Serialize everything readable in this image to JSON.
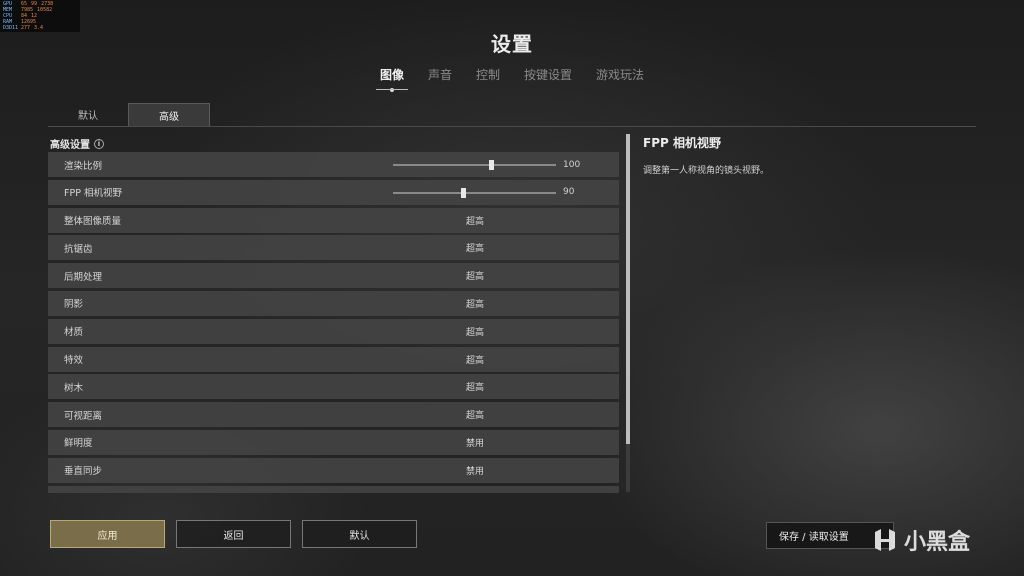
{
  "overlay": {
    "rows": [
      {
        "k": "GPU",
        "a": "65",
        "b": "99",
        "c": "2738"
      },
      {
        "k": "MEM",
        "a": "7985",
        "b": "10582",
        "c": ""
      },
      {
        "k": "CPU",
        "a": "84",
        "b": "12",
        "c": ""
      },
      {
        "k": "RAM",
        "a": "12695",
        "b": "",
        "c": ""
      },
      {
        "k": "D3D11",
        "a": "277",
        "b": "3.4",
        "c": ""
      }
    ]
  },
  "title": "设置",
  "main_tabs": [
    "图像",
    "声音",
    "控制",
    "按键设置",
    "游戏玩法"
  ],
  "sub_tabs": [
    "默认",
    "高级"
  ],
  "section_title": "高级设置",
  "settings": [
    {
      "label": "渲染比例",
      "type": "slider",
      "value": "100",
      "fraction": 0.6
    },
    {
      "label": "FPP 相机视野",
      "type": "slider",
      "value": "90",
      "fraction": 0.43
    },
    {
      "label": "整体图像质量",
      "type": "value",
      "value": "超高"
    },
    {
      "label": "抗锯齿",
      "type": "value",
      "value": "超高"
    },
    {
      "label": "后期处理",
      "type": "value",
      "value": "超高"
    },
    {
      "label": "阴影",
      "type": "value",
      "value": "超高"
    },
    {
      "label": "材质",
      "type": "value",
      "value": "超高"
    },
    {
      "label": "特效",
      "type": "value",
      "value": "超高"
    },
    {
      "label": "树木",
      "type": "value",
      "value": "超高"
    },
    {
      "label": "可视距离",
      "type": "value",
      "value": "超高"
    },
    {
      "label": "鲜明度",
      "type": "value",
      "value": "禁用"
    },
    {
      "label": "垂直同步",
      "type": "value",
      "value": "禁用"
    },
    {
      "label": "",
      "type": "value",
      "value": ""
    }
  ],
  "description": {
    "title": "FPP 相机视野",
    "text": "调整第一人称视角的镜头视野。"
  },
  "buttons": {
    "apply": "应用",
    "back": "返回",
    "default": "默认",
    "save_load": "保存 / 读取设置"
  },
  "watermark": "小黑盒",
  "colors": {
    "accent": "#7a6e4a",
    "row_bg": "#444444"
  }
}
